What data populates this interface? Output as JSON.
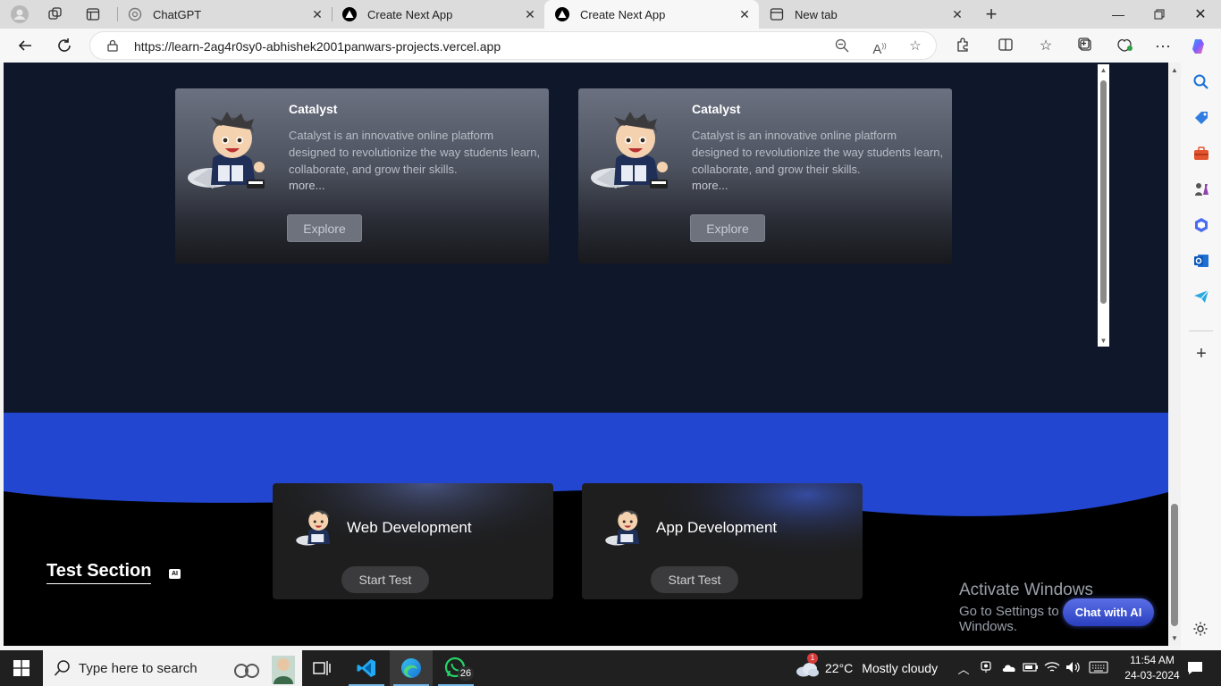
{
  "browser": {
    "tabs": [
      {
        "label": "ChatGPT",
        "active": false
      },
      {
        "label": "Create Next App",
        "active": false
      },
      {
        "label": "Create Next App",
        "active": true
      },
      {
        "label": "New tab",
        "active": false
      }
    ],
    "url": "https://learn-2ag4r0sy0-abhishek2001panwars-projects.vercel.app"
  },
  "page": {
    "course_cards": [
      {
        "title": "Catalyst",
        "description": "Catalyst is an innovative online platform designed to revolutionize the way students learn, collaborate, and grow their skills.",
        "more": "more...",
        "button": "Explore"
      },
      {
        "title": "Catalyst",
        "description": "Catalyst is an innovative online platform designed to revolutionize the way students learn, collaborate, and grow their skills.",
        "more": "more...",
        "button": "Explore"
      }
    ],
    "test_section": {
      "title": "Test Section",
      "badge": "AI",
      "cards": [
        {
          "label": "Web Development",
          "button": "Start Test"
        },
        {
          "label": "App Development",
          "button": "Start Test"
        }
      ]
    },
    "chat_button": "Chat with AI",
    "watermark": {
      "line1": "Activate Windows",
      "line2": "Go to Settings to activate Windows."
    }
  },
  "taskbar": {
    "search_placeholder": "Type here to search",
    "whatsapp_badge": "26",
    "weather_badge": "1",
    "temperature": "22°C",
    "weather": "Mostly cloudy",
    "time": "11:54 AM",
    "date": "24-03-2024"
  },
  "colors": {
    "page_bg": "#0f172a",
    "wave_blue": "#2346d0",
    "test_bg": "#000000",
    "card_dark": "#1e1e1f",
    "chat_accent": "#3b50d6"
  }
}
